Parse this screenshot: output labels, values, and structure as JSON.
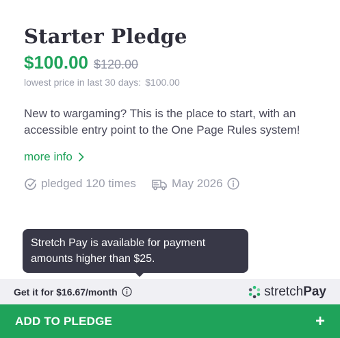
{
  "product": {
    "title": "Starter Pledge",
    "price": "$100.00",
    "old_price": "$120.00",
    "lowest_label": "lowest price in last 30 days:",
    "lowest_value": "$100.00",
    "description": "New to wargaming? This is the place to start, with an accessible entry point to the One Page Rules system!",
    "more_info": "more info",
    "pledged": "pledged 120 times",
    "delivery": "May 2026"
  },
  "tooltip": {
    "text": "Stretch Pay is available for payment amounts higher than $25."
  },
  "payment": {
    "monthly": "Get it for $16.67/month",
    "brand_part1": "stretch",
    "brand_part2": "Pay"
  },
  "cta": {
    "label": "ADD TO PLEDGE",
    "plus": "+"
  },
  "colors": {
    "accent": "#1fa35a",
    "tooltip_bg": "#383847",
    "pay_bar_bg": "#f0f0f4"
  },
  "icons": [
    "chevron-right-icon",
    "pledge-icon",
    "delivery-truck-icon",
    "info-icon",
    "stretchpay-logo-icon",
    "plus-icon"
  ]
}
